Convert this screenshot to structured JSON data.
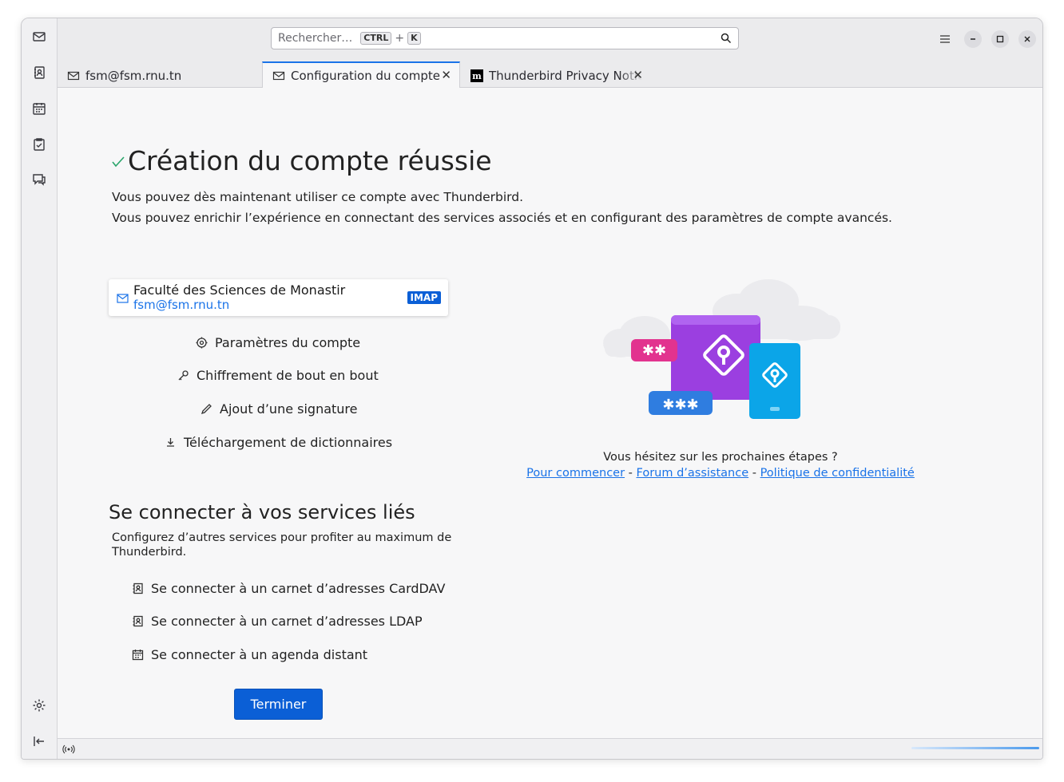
{
  "search": {
    "placeholder": "Rechercher…",
    "key1": "CTRL",
    "plus": "+",
    "key2": "K"
  },
  "tabs": [
    {
      "label": "fsm@fsm.rnu.tn"
    },
    {
      "label": "Configuration du compte"
    },
    {
      "label": "Thunderbird Privacy Notice"
    }
  ],
  "page": {
    "title": "Création du compte réussie",
    "desc1": "Vous pouvez dès maintenant utiliser ce compte avec Thunderbird.",
    "desc2": "Vous pouvez enrichir l’expérience en connectant des services associés et en configurant des paramètres de compte avancés."
  },
  "account": {
    "name": "Faculté des Sciences de Monastir",
    "email": "fsm@fsm.rnu.tn",
    "type": "IMAP"
  },
  "actions": [
    {
      "label": "Paramètres du compte",
      "icon": "gear-icon"
    },
    {
      "label": "Chiffrement de bout en bout",
      "icon": "key-icon"
    },
    {
      "label": "Ajout d’une signature",
      "icon": "pencil-icon"
    },
    {
      "label": "Téléchargement de dictionnaires",
      "icon": "download-icon"
    }
  ],
  "services": {
    "title": "Se connecter à vos services liés",
    "subtitle": "Configurez d’autres services pour profiter au maximum de Thunderbird.",
    "items": [
      {
        "label": "Se connecter à un carnet d’adresses CardDAV",
        "icon": "address-book-icon"
      },
      {
        "label": "Se connecter à un carnet d’adresses LDAP",
        "icon": "address-book-icon"
      },
      {
        "label": "Se connecter à un agenda distant",
        "icon": "calendar-icon"
      }
    ]
  },
  "finish_label": "Terminer",
  "help": {
    "question": "Vous hésitez sur les prochaines étapes ?",
    "link1": "Pour commencer",
    "sep": " - ",
    "link2": "Forum d’assistance",
    "link3": "Politique de confidentialité"
  },
  "colors": {
    "accent": "#0b5fd6",
    "link": "#1a73e8"
  }
}
